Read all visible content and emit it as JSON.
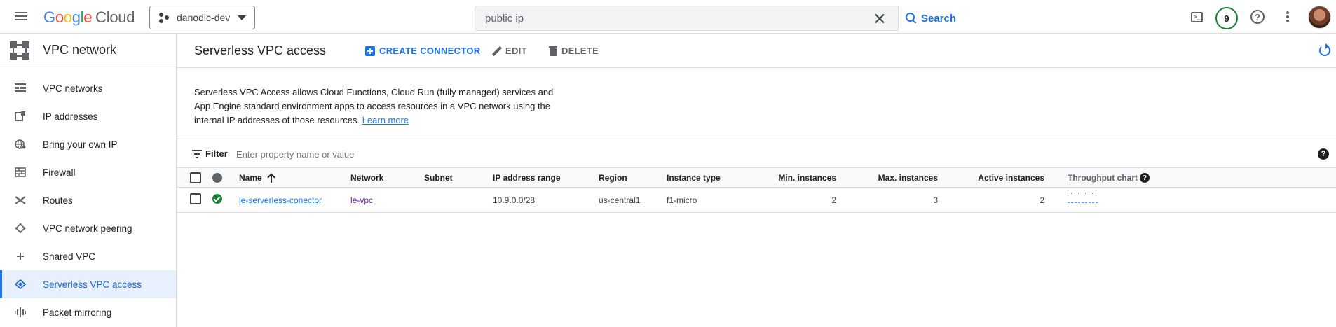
{
  "topbar": {
    "logo_google": "Google",
    "logo_cloud": "Cloud",
    "project": "danodic-dev",
    "search": {
      "value": "public ip",
      "button_label": "Search"
    },
    "notification_count": "9"
  },
  "sidenav": {
    "title": "VPC network",
    "items": [
      {
        "label": "VPC networks",
        "icon": "vpc-networks-icon"
      },
      {
        "label": "IP addresses",
        "icon": "ip-addresses-icon"
      },
      {
        "label": "Bring your own IP",
        "icon": "globe-icon"
      },
      {
        "label": "Firewall",
        "icon": "firewall-icon"
      },
      {
        "label": "Routes",
        "icon": "routes-icon"
      },
      {
        "label": "VPC network peering",
        "icon": "peering-icon"
      },
      {
        "label": "Shared VPC",
        "icon": "shared-vpc-icon"
      },
      {
        "label": "Serverless VPC access",
        "icon": "serverless-icon",
        "active": true
      },
      {
        "label": "Packet mirroring",
        "icon": "packet-mirroring-icon"
      }
    ]
  },
  "main": {
    "title": "Serverless VPC access",
    "actions": {
      "create": "CREATE CONNECTOR",
      "edit": "EDIT",
      "delete": "DELETE"
    },
    "description": {
      "line1": "Serverless VPC Access allows Cloud Functions, Cloud Run (fully managed) services and",
      "line2": "App Engine standard environment apps to access resources in a VPC network using the",
      "line3": "internal IP addresses of those resources.",
      "learn_more": "Learn more"
    },
    "filter": {
      "label": "Filter",
      "placeholder": "Enter property name or value"
    },
    "table": {
      "columns": {
        "name": "Name",
        "network": "Network",
        "subnet": "Subnet",
        "ip_range": "IP address range",
        "region": "Region",
        "instance_type": "Instance type",
        "min_instances": "Min. instances",
        "max_instances": "Max. instances",
        "active_instances": "Active instances",
        "throughput": "Throughput chart"
      },
      "rows": [
        {
          "status": "ok",
          "name": "le-serverless-conector",
          "network": "le-vpc",
          "subnet": "",
          "ip_range": "10.9.0.0/28",
          "region": "us-central1",
          "instance_type": "f1-micro",
          "min_instances": "2",
          "max_instances": "3",
          "active_instances": "2"
        }
      ]
    }
  },
  "colors": {
    "accent": "#1a73e8",
    "success": "#188038",
    "visited_link": "#681da8",
    "active_nav_bg": "#e8f0fe"
  }
}
